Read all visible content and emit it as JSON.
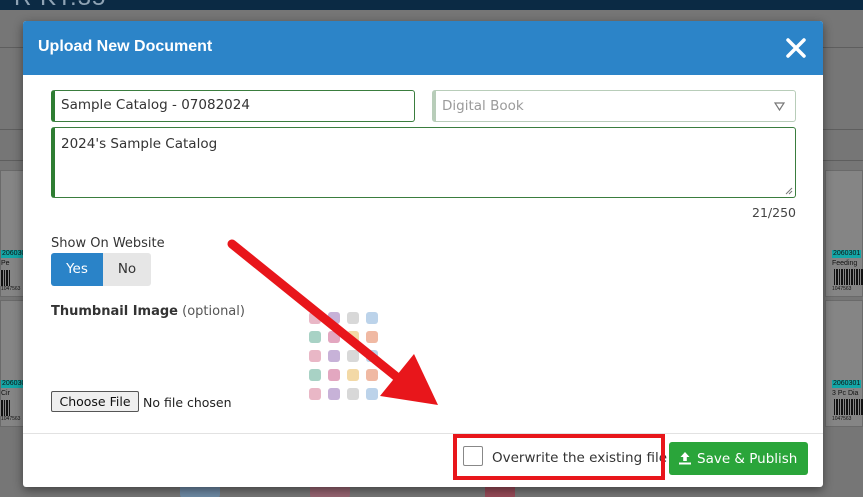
{
  "background": {
    "app_title_fragment": "R  KT.35",
    "tags": [
      "2060301",
      "2060301",
      "2060301",
      "2060301"
    ],
    "names": [
      "Pe",
      "Feeding",
      "Cir",
      "3 Pc Dia"
    ],
    "codes": [
      "1047563",
      "1047563",
      "1047563",
      "1047563"
    ]
  },
  "modal": {
    "title": "Upload New Document",
    "close_icon": "close-icon",
    "title_input_value": "Sample Catalog - 07082024",
    "type_select_placeholder": "Digital Book",
    "description_value": "2024's Sample Catalog",
    "char_count": "21/250",
    "show_on_website_label": "Show On Website",
    "show_yes": "Yes",
    "show_no": "No",
    "show_selected": "Yes",
    "thumbnail_label": "Thumbnail Image",
    "thumbnail_optional": "(optional)",
    "choose_file_label": "Choose File",
    "no_file_text": "No file chosen",
    "overwrite_label": "Overwrite the existing file",
    "overwrite_checked": false,
    "publish_label": "Save & Publish",
    "publish_icon": "upload-icon"
  },
  "colors": {
    "header_blue": "#2c84c8",
    "toggle_active": "#2a83c8",
    "field_border_green": "#2e7d32",
    "publish_green": "#2aa53a",
    "annotation_red": "#e8161b"
  }
}
